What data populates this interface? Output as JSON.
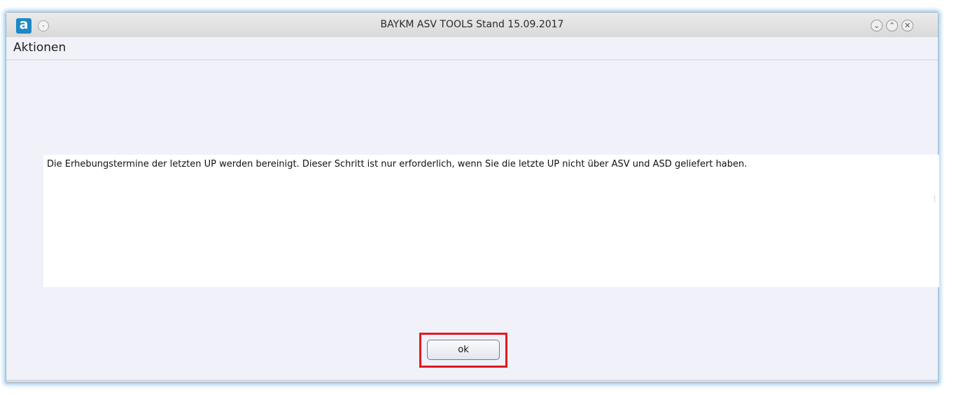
{
  "window": {
    "title": "BAYKM ASV TOOLS Stand 15.09.2017",
    "app_icon_letter": "a",
    "controls": {
      "minimize_glyph": "⌄",
      "maximize_glyph": "⌃",
      "close_glyph": "✕"
    }
  },
  "menubar": {
    "items": [
      {
        "label": "Aktionen"
      }
    ]
  },
  "message": {
    "text": "Die Erhebungstermine der letzten UP werden bereinigt. Dieser Schritt ist nur erforderlich, wenn Sie die letzte UP nicht über ASV und ASD geliefert haben."
  },
  "actions": {
    "ok_label": "ok"
  },
  "colors": {
    "accent_icon": "#1e88c7",
    "highlight": "#e01a22",
    "window_glow": "#a9d3ef"
  }
}
